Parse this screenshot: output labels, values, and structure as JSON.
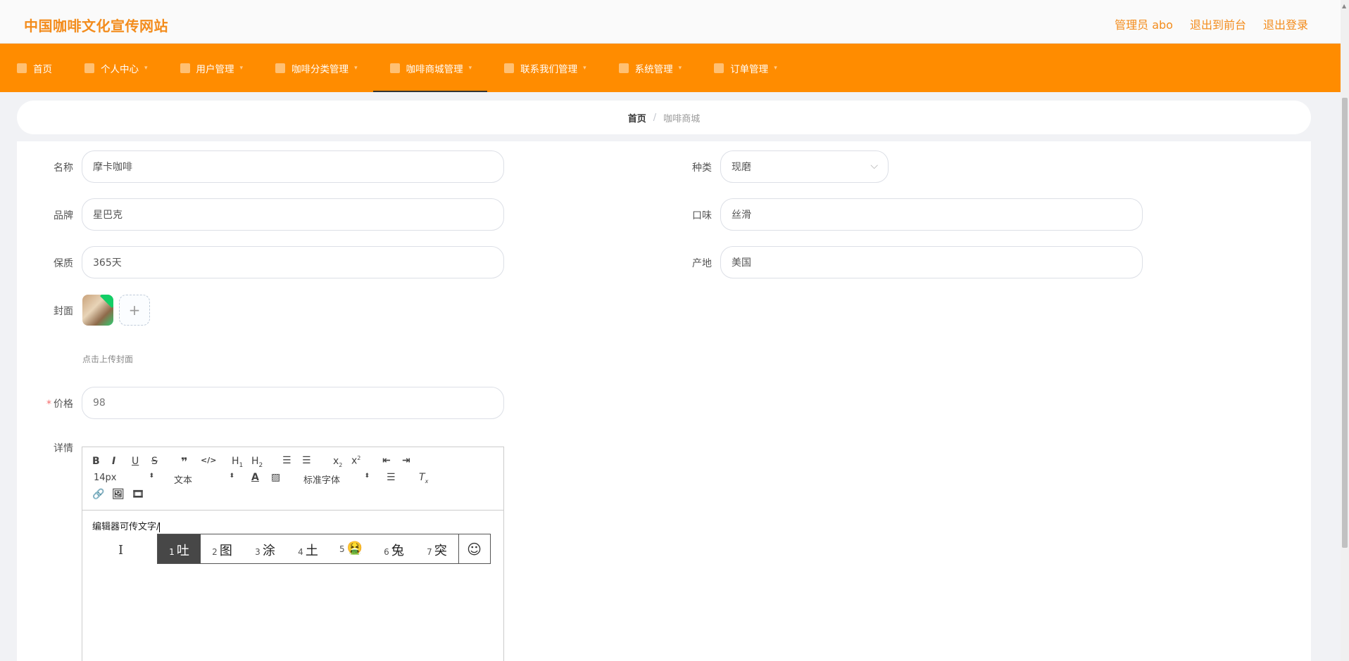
{
  "header": {
    "title": "中国咖啡文化宣传网站",
    "admin_label": "管理员 abo",
    "to_front": "退出到前台",
    "logout": "退出登录"
  },
  "nav": {
    "items": [
      {
        "label": "首页",
        "icon": "home-icon"
      },
      {
        "label": "个人中心",
        "icon": "user-icon"
      },
      {
        "label": "用户管理",
        "icon": "power-icon"
      },
      {
        "label": "咖啡分类管理",
        "icon": "list-icon"
      },
      {
        "label": "咖啡商城管理",
        "icon": "location-icon"
      },
      {
        "label": "联系我们管理",
        "icon": "chat-icon"
      },
      {
        "label": "系统管理",
        "icon": "settings-icon"
      },
      {
        "label": "订单管理",
        "icon": "order-icon"
      }
    ],
    "active_index": 4
  },
  "breadcrumb": {
    "home": "首页",
    "separator": "/",
    "current": "咖啡商城"
  },
  "form": {
    "name_label": "名称",
    "name_value": "摩卡咖啡",
    "category_label": "种类",
    "category_value": "现磨",
    "brand_label": "品牌",
    "brand_value": "星巴克",
    "taste_label": "口味",
    "taste_value": "丝滑",
    "shelf_label": "保质",
    "shelf_value": "365天",
    "origin_label": "产地",
    "origin_value": "美国",
    "cover_label": "封面",
    "cover_hint": "点击上传封面",
    "upload_plus": "+",
    "price_label": "价格",
    "price_required": "*",
    "price_value": "98",
    "detail_label": "详情"
  },
  "editor": {
    "font_size": "14px",
    "block_type": "文本",
    "font_family": "标准字体",
    "content": "编辑器可传文字/"
  },
  "ime": {
    "candidates": [
      {
        "num": "1",
        "text": "吐"
      },
      {
        "num": "2",
        "text": "图"
      },
      {
        "num": "3",
        "text": "涂"
      },
      {
        "num": "4",
        "text": "土"
      },
      {
        "num": "5",
        "text": "🤮"
      },
      {
        "num": "6",
        "text": "兔"
      },
      {
        "num": "7",
        "text": "突"
      }
    ],
    "emoji_button": "☺"
  }
}
